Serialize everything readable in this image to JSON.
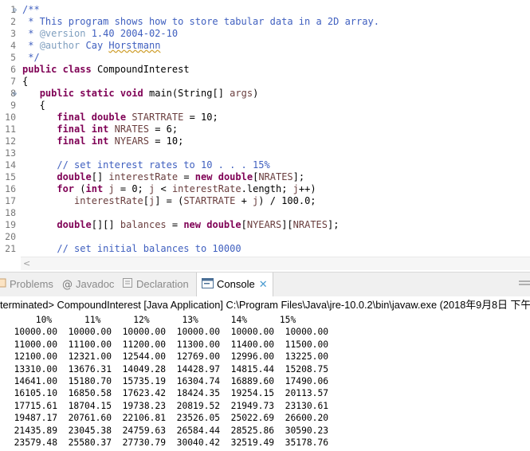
{
  "editor": {
    "lines": [
      {
        "n": "1",
        "fold": "⊖",
        "html": "<span class=\"cmt\">/**</span>"
      },
      {
        "n": "2",
        "html": "<span class=\"cmt\"> * This program shows how to store tabular data in a 2D array.</span>"
      },
      {
        "n": "3",
        "html": "<span class=\"cmt\"> * <span class=\"jdtag\" style=\"font-weight:normal\">@version</span> 1.40 2004-02-10</span>"
      },
      {
        "n": "4",
        "html": "<span class=\"cmt\"> * <span class=\"jdtag\" style=\"font-weight:normal\">@author</span> Cay <span class=\"typo\">Horstmann</span></span>"
      },
      {
        "n": "5",
        "html": "<span class=\"cmt\"> */</span>"
      },
      {
        "n": "6",
        "html": "<span class=\"kw\">public</span> <span class=\"kw\">class</span> CompoundInterest"
      },
      {
        "n": "7",
        "html": "{"
      },
      {
        "n": "8",
        "fold": "⊖",
        "html": "   <span class=\"kw\">public</span> <span class=\"kw\">static</span> <span class=\"kw\">void</span> main(String[] <span class=\"var\">args</span>)"
      },
      {
        "n": "9",
        "html": "   {"
      },
      {
        "n": "10",
        "html": "      <span class=\"kw\">final</span> <span class=\"kw\">double</span> <span class=\"var\">STARTRATE</span> = 10;"
      },
      {
        "n": "11",
        "html": "      <span class=\"kw\">final</span> <span class=\"kw\">int</span> <span class=\"var\">NRATES</span> = 6;"
      },
      {
        "n": "12",
        "html": "      <span class=\"kw\">final</span> <span class=\"kw\">int</span> <span class=\"var\">NYEARS</span> = 10;"
      },
      {
        "n": "13",
        "html": ""
      },
      {
        "n": "14",
        "html": "      <span class=\"cmt\">// set interest rates to 10 . . . 15%</span>"
      },
      {
        "n": "15",
        "html": "      <span class=\"kw\">double</span>[] <span class=\"var\">interestRate</span> = <span class=\"kw\">new</span> <span class=\"kw\">double</span>[<span class=\"var\">NRATES</span>];"
      },
      {
        "n": "16",
        "html": "      <span class=\"kw\">for</span> (<span class=\"kw\">int</span> <span class=\"var\">j</span> = 0; <span class=\"var\">j</span> &lt; <span class=\"var\">interestRate</span>.length; <span class=\"var\">j</span>++)"
      },
      {
        "n": "17",
        "html": "         <span class=\"var\">interestRate</span>[<span class=\"var\">j</span>] = (<span class=\"var\">STARTRATE</span> + <span class=\"var\">j</span>) / 100.0;"
      },
      {
        "n": "18",
        "html": ""
      },
      {
        "n": "19",
        "html": "      <span class=\"kw\">double</span>[][] <span class=\"var\">balances</span> = <span class=\"kw\">new</span> <span class=\"kw\">double</span>[<span class=\"var\">NYEARS</span>][<span class=\"var\">NRATES</span>];"
      },
      {
        "n": "20",
        "html": ""
      },
      {
        "n": "21",
        "html": "      <span class=\"cmt\">// set initial balances to 10000</span>"
      }
    ]
  },
  "tabs": {
    "problems": "Problems",
    "javadoc": "Javadoc",
    "declaration": "Declaration",
    "console": "Console",
    "close_glyph": "✕"
  },
  "console": {
    "header": "terminated> CompoundInterest [Java Application] C:\\Program Files\\Java\\jre-10.0.2\\bin\\javaw.exe (2018年9月8日 下午",
    "lines": [
      "      10%      11%      12%      13%      14%      15%",
      "  10000.00  10000.00  10000.00  10000.00  10000.00  10000.00",
      "  11000.00  11100.00  11200.00  11300.00  11400.00  11500.00",
      "  12100.00  12321.00  12544.00  12769.00  12996.00  13225.00",
      "  13310.00  13676.31  14049.28  14428.97  14815.44  15208.75",
      "  14641.00  15180.70  15735.19  16304.74  16889.60  17490.06",
      "  16105.10  16850.58  17623.42  18424.35  19254.15  20113.57",
      "  17715.61  18704.15  19738.23  20819.52  21949.73  23130.61",
      "  19487.17  20761.60  22106.81  23526.05  25022.69  26600.20",
      "  21435.89  23045.38  24759.63  26584.44  28525.86  30590.23",
      "  23579.48  25580.37  27730.79  30040.42  32519.49  35178.76"
    ]
  }
}
